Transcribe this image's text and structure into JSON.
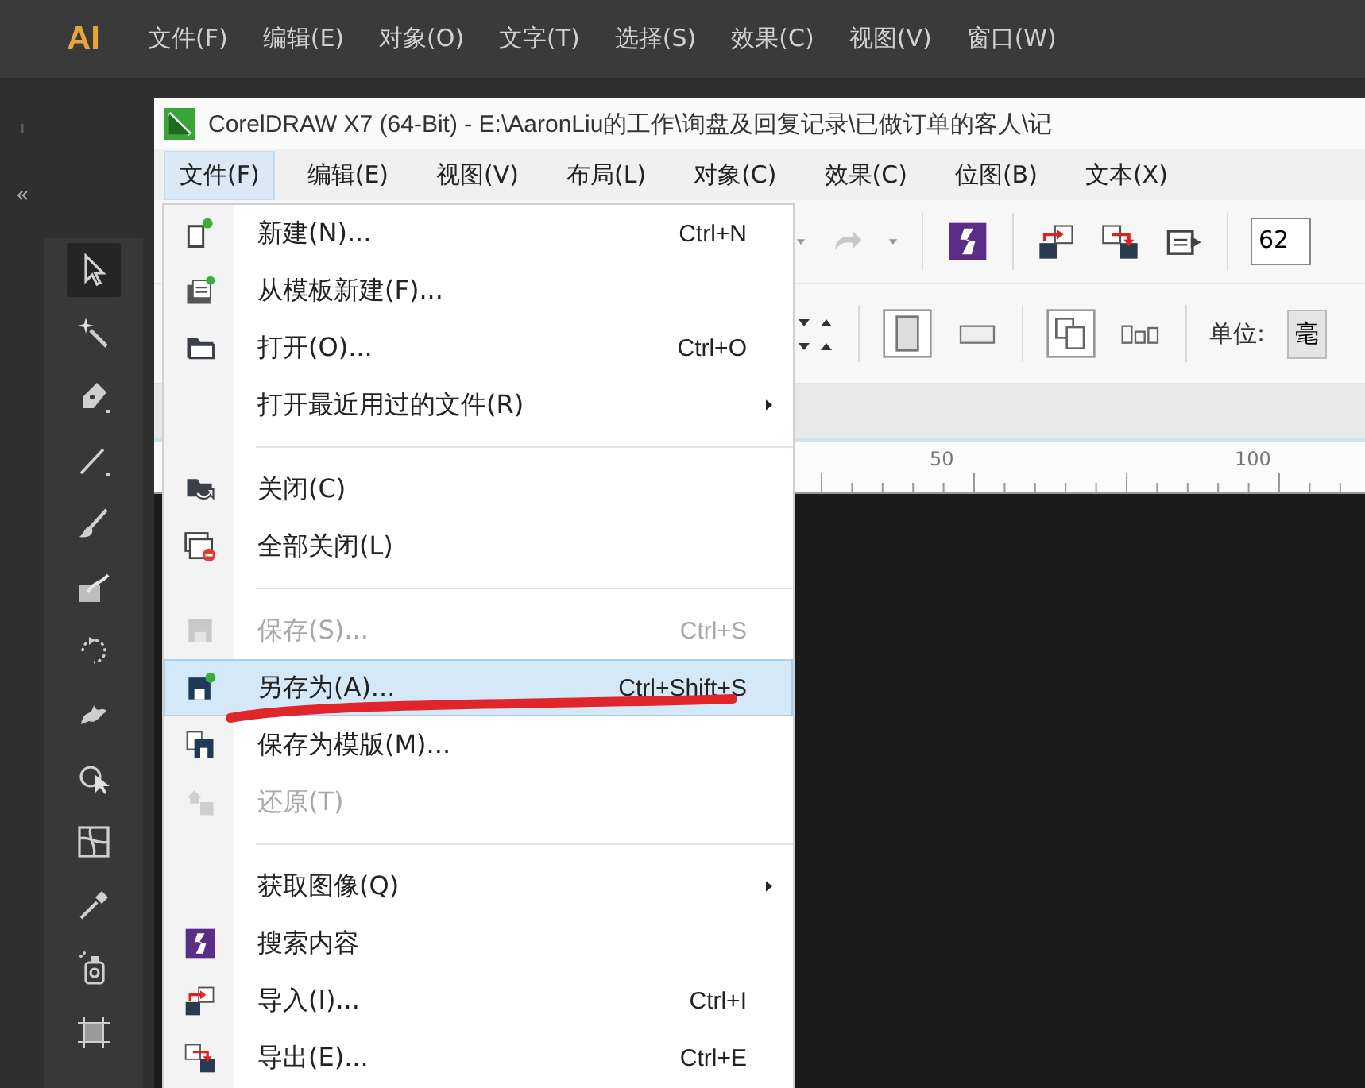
{
  "ai_app": {
    "logo": "AI",
    "menu": [
      "文件(F)",
      "编辑(E)",
      "对象(O)",
      "文字(T)",
      "选择(S)",
      "效果(C)",
      "视图(V)",
      "窗口(W)"
    ],
    "tools": [
      {
        "kind": "selection",
        "selected": true
      },
      {
        "kind": "magic-wand",
        "selected": false
      },
      {
        "kind": "pen",
        "selected": false
      },
      {
        "kind": "line",
        "selected": false
      },
      {
        "kind": "brush",
        "selected": false
      },
      {
        "kind": "shaper",
        "selected": false
      },
      {
        "kind": "rotate",
        "selected": false
      },
      {
        "kind": "warp",
        "selected": false
      },
      {
        "kind": "shape-builder",
        "selected": false
      },
      {
        "kind": "mesh",
        "selected": false
      },
      {
        "kind": "eyedropper",
        "selected": false
      },
      {
        "kind": "sprayer",
        "selected": false
      },
      {
        "kind": "artboard",
        "selected": false
      }
    ]
  },
  "corel_window": {
    "title": "CorelDRAW X7 (64-Bit) - E:\\AaronLiu的工作\\询盘及回复记录\\已做订单的客人\\记",
    "menu": [
      {
        "label": "文件(F)",
        "selected": true
      },
      {
        "label": "编辑(E)",
        "selected": false
      },
      {
        "label": "视图(V)",
        "selected": false
      },
      {
        "label": "布局(L)",
        "selected": false
      },
      {
        "label": "对象(C)",
        "selected": false
      },
      {
        "label": "效果(C)",
        "selected": false
      },
      {
        "label": "位图(B)",
        "selected": false
      },
      {
        "label": "文本(X)",
        "selected": false
      }
    ],
    "zoom_field": {
      "value": "62"
    },
    "units": {
      "label": "单位:",
      "value": "毫"
    },
    "ruler_labels": [
      "50",
      "100"
    ]
  },
  "file_menu": {
    "items": [
      {
        "kind": "item",
        "label": "新建(N)...",
        "shortcut": "Ctrl+N",
        "disabled": false,
        "selected": false,
        "submenu": false
      },
      {
        "kind": "item",
        "label": "从模板新建(F)...",
        "disabled": false,
        "selected": false,
        "submenu": false
      },
      {
        "kind": "item",
        "label": "打开(O)...",
        "shortcut": "Ctrl+O",
        "disabled": false,
        "selected": false,
        "submenu": false
      },
      {
        "kind": "item",
        "label": "打开最近用过的文件(R)",
        "disabled": false,
        "selected": false,
        "submenu": true
      },
      {
        "kind": "separator"
      },
      {
        "kind": "item",
        "label": "关闭(C)",
        "disabled": false,
        "selected": false,
        "submenu": false
      },
      {
        "kind": "item",
        "label": "全部关闭(L)",
        "disabled": false,
        "selected": false,
        "submenu": false
      },
      {
        "kind": "separator"
      },
      {
        "kind": "item",
        "label": "保存(S)...",
        "shortcut": "Ctrl+S",
        "disabled": true,
        "selected": false,
        "submenu": false
      },
      {
        "kind": "item",
        "label": "另存为(A)...",
        "shortcut": "Ctrl+Shift+S",
        "disabled": false,
        "selected": true,
        "submenu": false
      },
      {
        "kind": "item",
        "label": "保存为模版(M)...",
        "disabled": false,
        "selected": false,
        "submenu": false
      },
      {
        "kind": "item",
        "label": "还原(T)",
        "disabled": true,
        "selected": false,
        "submenu": false
      },
      {
        "kind": "separator"
      },
      {
        "kind": "item",
        "label": "获取图像(Q)",
        "disabled": false,
        "selected": false,
        "submenu": true
      },
      {
        "kind": "item",
        "label": "搜索内容",
        "disabled": false,
        "selected": false,
        "submenu": false
      },
      {
        "kind": "item",
        "label": "导入(I)...",
        "shortcut": "Ctrl+I",
        "disabled": false,
        "selected": false,
        "submenu": false
      },
      {
        "kind": "item",
        "label": "导出(E)...",
        "shortcut": "Ctrl+E",
        "disabled": false,
        "selected": false,
        "submenu": false
      }
    ]
  }
}
